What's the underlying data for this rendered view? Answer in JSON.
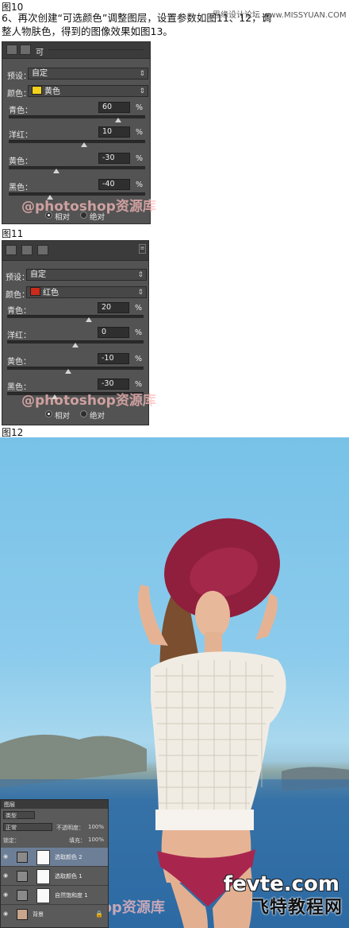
{
  "captions": {
    "fig10": "图10",
    "fig11": "图11",
    "fig12": "图12"
  },
  "site": "思缘设计论坛 www.MISSYUAN.COM",
  "intro": {
    "line1": "6、再次创建“可选颜色”调整图层，设置参数如图11、12，调",
    "line2": "整人物肤色，得到的图像效果如图13。"
  },
  "panel1": {
    "title": "可",
    "preset_label": "预设：",
    "preset_value": "自定",
    "color_label": "颜色：",
    "color_value": "黄色",
    "color_swatch": "#f2d21c",
    "sliders": [
      {
        "label": "青色：",
        "value": "60",
        "unit": "%",
        "level": 60
      },
      {
        "label": "洋红：",
        "value": "10",
        "unit": "%",
        "level": 10
      },
      {
        "label": "黄色：",
        "value": "-30",
        "unit": "%",
        "level": -30
      },
      {
        "label": "黑色：",
        "value": "-40",
        "unit": "%",
        "level": -40
      }
    ],
    "watermark": "@photoshop资源库",
    "radio_relative": "相对",
    "radio_absolute": "绝对",
    "method": "relative"
  },
  "panel2": {
    "preset_label": "预设：",
    "preset_value": "自定",
    "color_label": "颜色：",
    "color_value": "红色",
    "color_swatch": "#cc2a1a",
    "sliders": [
      {
        "label": "青色：",
        "value": "20",
        "unit": "%",
        "level": 20
      },
      {
        "label": "洋红：",
        "value": "0",
        "unit": "%",
        "level": 0
      },
      {
        "label": "黄色：",
        "value": "-10",
        "unit": "%",
        "level": -10
      },
      {
        "label": "黑色：",
        "value": "-30",
        "unit": "%",
        "level": -30
      }
    ],
    "watermark": "@photoshop资源库",
    "radio_relative": "相对",
    "radio_absolute": "绝对",
    "method": "relative"
  },
  "layers_panel": {
    "tab": "图层",
    "filter": "类型",
    "blend_mode": "正常",
    "opacity_label": "不透明度：",
    "opacity_value": "100%",
    "lock_label": "锁定：",
    "fill_label": "填充：",
    "fill_value": "100%",
    "layers": [
      {
        "name": "选取颜色 2",
        "active": true
      },
      {
        "name": "选取颜色 1",
        "active": false
      },
      {
        "name": "自然饱和度 1",
        "active": false
      },
      {
        "name": "背景",
        "active": false
      }
    ]
  },
  "photo_watermark": "@photoshop资源库",
  "logo": {
    "en": "fevte.com",
    "cn": "飞特教程网"
  }
}
